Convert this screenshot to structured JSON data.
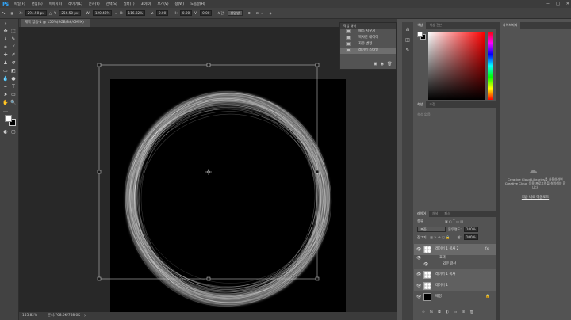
{
  "app": {
    "logo": "Ps"
  },
  "menu": [
    "파일(F)",
    "편집(E)",
    "이미지(I)",
    "레이어(L)",
    "문자(Y)",
    "선택(S)",
    "필터(T)",
    "3D(D)",
    "보기(V)",
    "창(W)",
    "도움말(H)"
  ],
  "window_controls": [
    "−",
    "□",
    "✕"
  ],
  "options": {
    "x_label": "X:",
    "x": "294.50 px",
    "y_label": "Y:",
    "y": "256.50 px",
    "w_label": "W:",
    "w": "120.46%",
    "h_label": "H:",
    "h": "116.82%",
    "angle": "0.00",
    "hskew_label": "H:",
    "hskew": "0.00",
    "vskew_label": "V:",
    "vskew": "0.00",
    "interp_label": "보간:",
    "interp": "쌍입방"
  },
  "document": {
    "tab_title": "제목 없음-1 @ 156%(RGB/8#/CMYK) *",
    "status_zoom": "155.82%",
    "status_doc": "문서:768.0K/768.0K"
  },
  "history": {
    "title": "작업 내역",
    "items": [
      "패스 지우기",
      "복사한 레이어",
      "자유 변형",
      "레이어 스타일"
    ],
    "selected_index": 3
  },
  "color_panel": {
    "tabs": [
      "색상",
      "색상 견본"
    ],
    "active": 0
  },
  "properties_panel": {
    "tabs": [
      "속성",
      "조정"
    ],
    "active": 0,
    "placeholder": "속성 없음"
  },
  "layers_panel": {
    "tabs": [
      "레이어",
      "채널",
      "패스"
    ],
    "kind_label": "종류",
    "blend_mode": "표준",
    "opacity_label": "불투명도:",
    "opacity": "100%",
    "lock_label": "잠그기:",
    "fill_label": "칠:",
    "fill": "100%",
    "layers": [
      {
        "name": "레이어 1 복사 2",
        "fx": "fx",
        "type": "trans",
        "selected": true
      },
      {
        "name": "효과",
        "type": "effect"
      },
      {
        "name": "외부 광선",
        "type": "effect-item"
      },
      {
        "name": "레이어 1 복사",
        "type": "trans"
      },
      {
        "name": "레이어 1",
        "type": "trans"
      },
      {
        "name": "배경",
        "type": "bg"
      }
    ]
  },
  "libraries": {
    "title": "라이브러리",
    "message": "Creative Cloud Libraries를 사용하려면 Creative Cloud 응용 프로그램을 설치해야 합니다.",
    "link": "지금 바로 다운로드"
  },
  "colors": {
    "accent": "#31a8ff",
    "canvas_bg": "#000000",
    "ui_bg": "#535353"
  }
}
